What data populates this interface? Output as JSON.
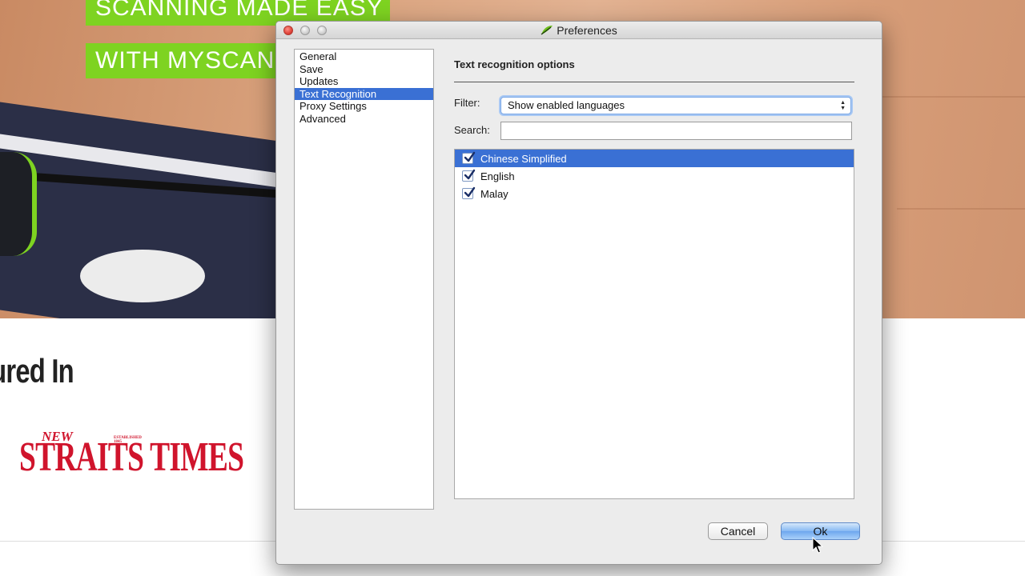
{
  "background": {
    "banner_line1": "SCANNING MADE EASY",
    "banner_line2": "WITH MYSCAN",
    "featured_heading": "tured In",
    "logo_text_small": "NEW",
    "logo_text_tiny": "ESTABLISHED 1845",
    "logo_text_big": "STRAITS TIMES"
  },
  "window": {
    "title": "Preferences",
    "app_icon": "myscan-leaf-icon"
  },
  "sidebar": {
    "items": [
      {
        "label": "General",
        "selected": false
      },
      {
        "label": "Save",
        "selected": false
      },
      {
        "label": "Updates",
        "selected": false
      },
      {
        "label": "Text Recognition",
        "selected": true
      },
      {
        "label": "Proxy Settings",
        "selected": false
      },
      {
        "label": "Advanced",
        "selected": false
      }
    ]
  },
  "pane": {
    "heading": "Text recognition options",
    "filter_label": "Filter:",
    "filter_value": "Show enabled languages",
    "search_label": "Search:",
    "search_value": "",
    "languages": [
      {
        "name": "Chinese Simplified",
        "checked": true,
        "selected": true
      },
      {
        "name": "English",
        "checked": true,
        "selected": false
      },
      {
        "name": "Malay",
        "checked": true,
        "selected": false
      }
    ]
  },
  "buttons": {
    "cancel_label": "Cancel",
    "ok_label": "Ok"
  },
  "colors": {
    "selection": "#3a70d4",
    "banner_green": "#7ed321",
    "logo_red": "#d0142c",
    "close_red": "#e0443a"
  }
}
